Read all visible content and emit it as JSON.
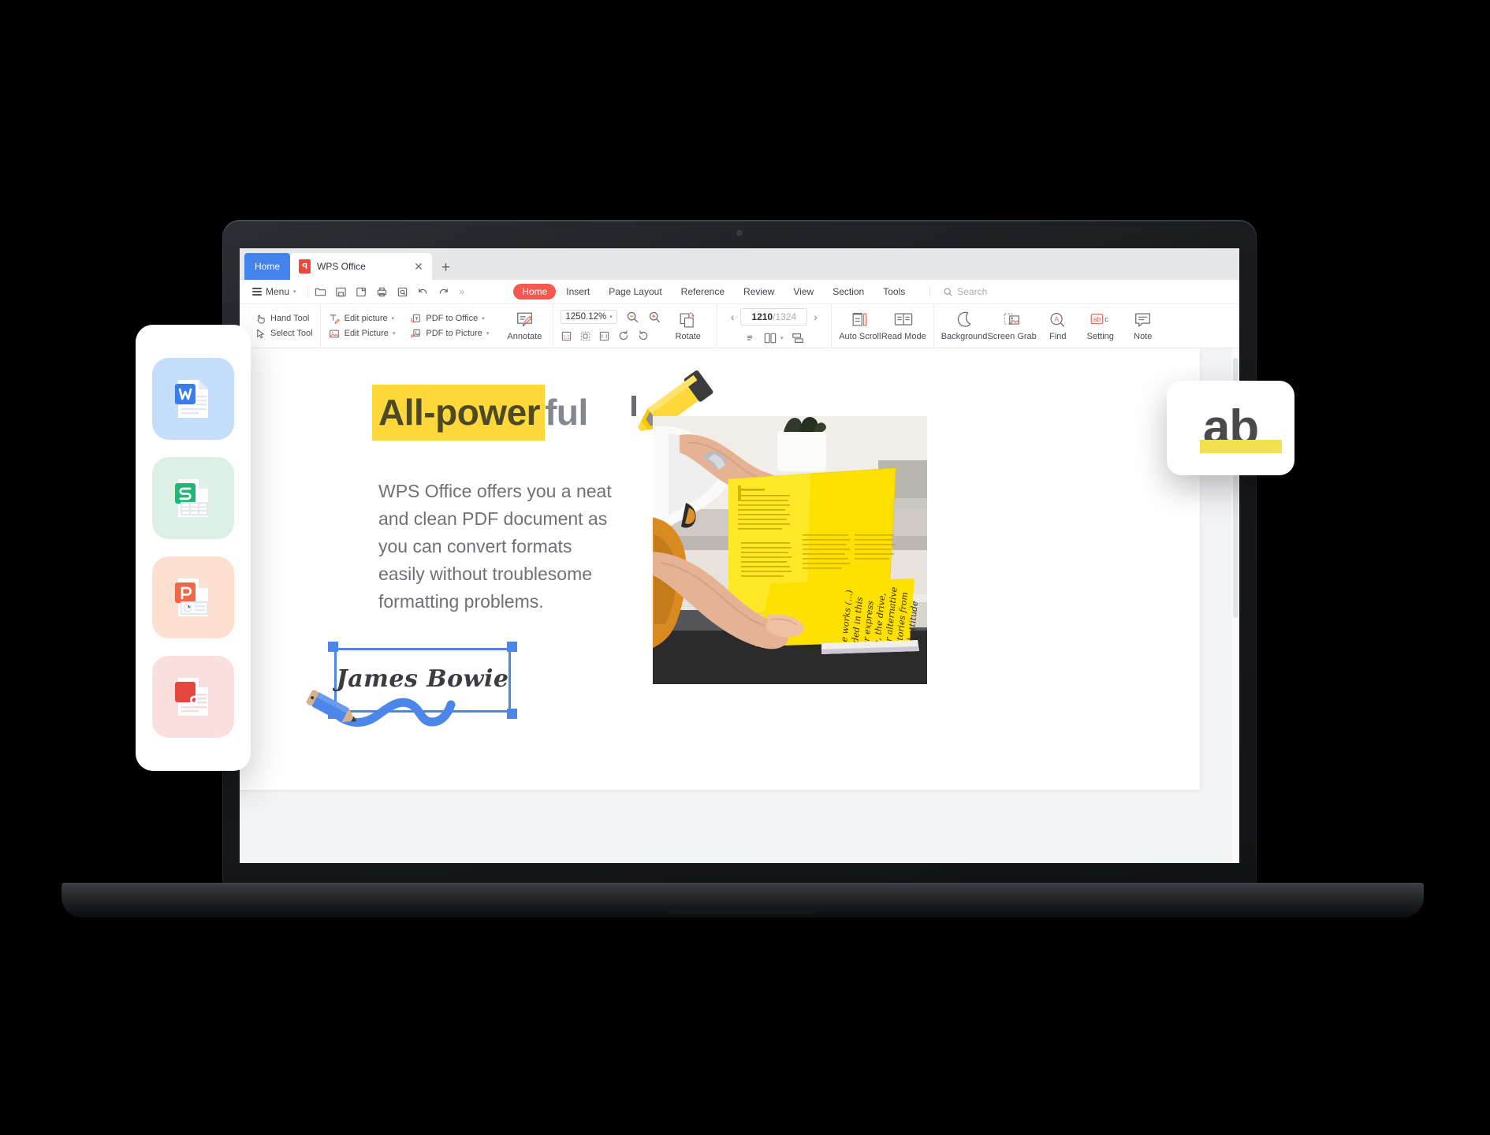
{
  "app": {
    "tabs": {
      "home_label": "Home",
      "document_label": "WPS Office",
      "document_icon": "pdf-file-icon",
      "close_icon": "close-icon",
      "new_tab_icon": "plus-icon"
    },
    "menu": {
      "label": "Menu",
      "caret": "▾",
      "quick_icons": [
        "open-folder-icon",
        "save-icon",
        "save-as-icon",
        "print-icon",
        "print-preview-icon",
        "undo-icon",
        "redo-icon"
      ],
      "more_icon": "»"
    },
    "ribbon": {
      "tabs": [
        "Home",
        "Insert",
        "Page Layout",
        "Reference",
        "Review",
        "View",
        "Section",
        "Tools"
      ],
      "active_tab": "Home",
      "accent_color": "#f5584f"
    },
    "search": {
      "icon": "search-icon",
      "placeholder": "Search"
    }
  },
  "toolbar": {
    "group_tools": [
      {
        "label": "Hand Tool",
        "icon": "hand-icon",
        "caret": ""
      },
      {
        "label": "Select Tool",
        "icon": "cursor-arrow-icon",
        "caret": ""
      }
    ],
    "group_edit": [
      {
        "label": "Edit picture",
        "icon": "edit-text-icon",
        "caret": "▾"
      },
      {
        "label": "Edit Picture",
        "icon": "image-icon",
        "caret": "▾"
      }
    ],
    "group_convert": [
      {
        "label": "PDF to Office",
        "icon": "pdf-to-office-icon",
        "caret": "▾"
      },
      {
        "label": "PDF to Picture",
        "icon": "pdf-to-picture-icon",
        "caret": "▾"
      }
    ],
    "annotate": {
      "label": "Annotate",
      "icon": "annotate-icon",
      "caret": "▾"
    },
    "zoom": {
      "value": "1250.12%",
      "caret": "▾",
      "zoom_out_icon": "zoom-out-icon",
      "zoom_in_icon": "zoom-in-icon",
      "fit_icons": [
        "actual-size-icon",
        "fit-page-icon",
        "fit-width-icon"
      ],
      "rotate_right_icon": "rotate-right-icon",
      "rotate_left_icon": "rotate-left-icon"
    },
    "rotate": {
      "label": "Rotate",
      "icon": "rotate-page-icon",
      "caret": "▾"
    },
    "pager": {
      "prev_icon": "‹",
      "next_icon": "›",
      "current_page": "1210",
      "separator": "/",
      "total_pages": "1324"
    },
    "view_modes": [
      "single-page-icon",
      "two-page-icon",
      "continuous-scroll-icon"
    ],
    "view_caret": "▾",
    "right_tools": [
      {
        "label": "Auto Scroll",
        "icon": "auto-scroll-icon",
        "caret": "▾"
      },
      {
        "label": "Read Mode",
        "icon": "read-mode-icon",
        "caret": "▾"
      },
      {
        "label": "Background",
        "icon": "moon-icon",
        "caret": "▾"
      },
      {
        "label": "Screen Grab",
        "icon": "screen-grab-icon",
        "caret": "▾"
      },
      {
        "label": "Find",
        "icon": "find-icon",
        "caret": "▾"
      },
      {
        "label": "Setting",
        "icon": "abc-setting-icon",
        "caret": "▾"
      },
      {
        "label": "Note",
        "icon": "note-icon",
        "caret": "▾"
      }
    ]
  },
  "document": {
    "heading_highlighted": "All-power",
    "heading_plain": "ful",
    "highlight_color": "#ffd93b",
    "body": "WPS Office offers you a neat and clean PDF document as you can convert formats easily without troublesome formatting problems.",
    "signature": "James Bowie",
    "photo_alt": "hands-holding-yellow-highlighted-book-photo",
    "marker_icon": "yellow-highlighter-marker",
    "selection_color": "#4c86ea"
  },
  "file_card": {
    "items": [
      {
        "name": "word-document-icon",
        "letter": "W",
        "accent": "#3a7cec",
        "tile": "#c5defb"
      },
      {
        "name": "spreadsheet-document-icon",
        "letter": "S",
        "accent": "#22b573",
        "tile": "#ddf0e5"
      },
      {
        "name": "presentation-document-icon",
        "letter": "P",
        "accent": "#f2674a",
        "tile": "#fde0d0"
      },
      {
        "name": "pdf-document-icon",
        "letter": "P",
        "accent": "#e3473f",
        "tile": "#fbdfdf"
      }
    ]
  },
  "ab_badge": {
    "text": "ab",
    "bar_color": "#f0e14e",
    "icon": "highlight-text-badge"
  }
}
